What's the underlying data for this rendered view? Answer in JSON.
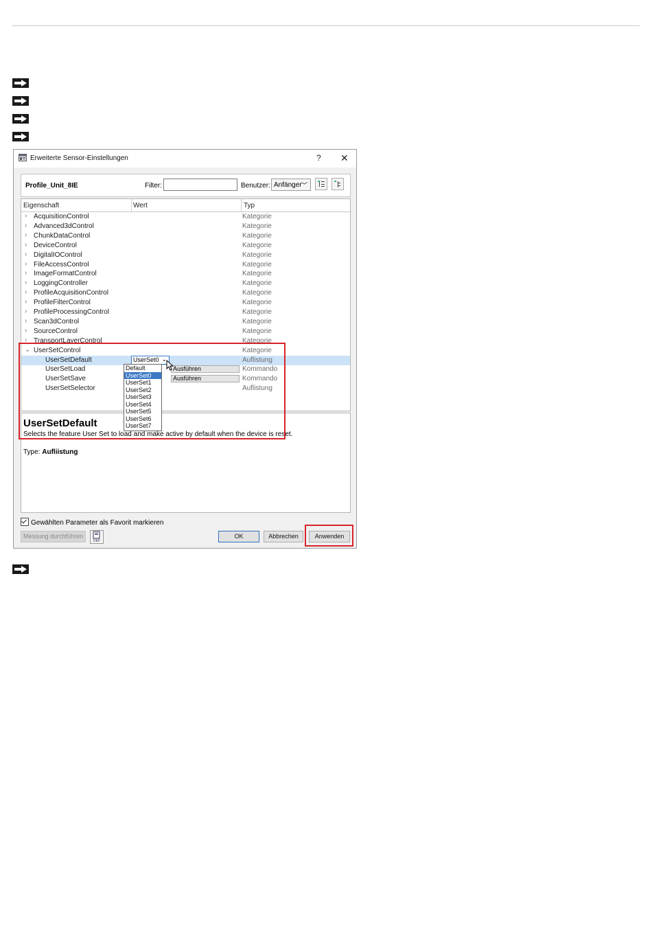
{
  "dialog": {
    "title": "Erweiterte Sensor-Einstellungen",
    "help_label": "?",
    "close_label": "✕",
    "toolbar": {
      "profile_name": "Profile_Unit_8IE",
      "filter_label": "Filter:",
      "filter_value": "",
      "user_label": "Benutzer:",
      "user_value": "Anfänger"
    },
    "columns": {
      "property": "Eigenschaft",
      "value": "Wert",
      "type": "Typ"
    },
    "rows": [
      {
        "name": "AcquisitionControl",
        "type": "Kategorie"
      },
      {
        "name": "Advanced3dControl",
        "type": "Kategorie"
      },
      {
        "name": "ChunkDataControl",
        "type": "Kategorie"
      },
      {
        "name": "DeviceControl",
        "type": "Kategorie"
      },
      {
        "name": "DigitalIOControl",
        "type": "Kategorie"
      },
      {
        "name": "FileAccessControl",
        "type": "Kategorie"
      },
      {
        "name": "ImageFormatControl",
        "type": "Kategorie"
      },
      {
        "name": "LoggingController",
        "type": "Kategorie"
      },
      {
        "name": "ProfileAcquisitionControl",
        "type": "Kategorie"
      },
      {
        "name": "ProfileFilterControl",
        "type": "Kategorie"
      },
      {
        "name": "ProfileProcessingControl",
        "type": "Kategorie"
      },
      {
        "name": "Scan3dControl",
        "type": "Kategorie"
      },
      {
        "name": "SourceControl",
        "type": "Kategorie"
      },
      {
        "name": "TransportLayerControl",
        "type": "Kategorie"
      },
      {
        "name": "UserSetControl",
        "type": "Kategorie"
      }
    ],
    "children": [
      {
        "name": "UserSetDefault",
        "value": "UserSet0",
        "type": "Auflistung"
      },
      {
        "name": "UserSetLoad",
        "value": "Ausführen",
        "type": "Kommando"
      },
      {
        "name": "UserSetSave",
        "value": "Ausführen",
        "type": "Kommando"
      },
      {
        "name": "UserSetSelector",
        "value": "",
        "type": "Auflistung"
      }
    ],
    "dropdown_options": [
      "Default",
      "UserSet0",
      "UserSet1",
      "UserSet2",
      "UserSet3",
      "UserSet4",
      "UserSet5",
      "UserSet6",
      "UserSet7"
    ],
    "dropdown_selected": "UserSet0",
    "description": {
      "title": "UserSetDefault",
      "text": "Selects the feature User Set to load and make active by default when the device is reset.",
      "type_label": "Type:",
      "type_value": "Aufliistung"
    },
    "favorite_label": "Gewählten Parameter als Favorit markieren",
    "favorite_checked": true,
    "buttons": {
      "measure": "Messung durchführen",
      "def": "DEF",
      "ok": "OK",
      "cancel": "Abbrechen",
      "apply": "Anwenden"
    }
  },
  "colors": {
    "highlight_red": "#d8232a",
    "selection_blue": "#3b78c4",
    "row_selected": "#cce3f7"
  }
}
